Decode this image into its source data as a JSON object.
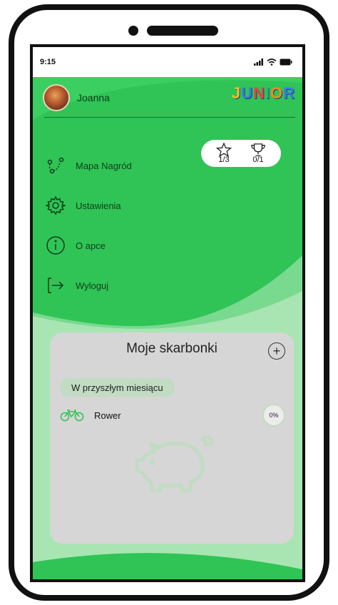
{
  "status_bar": {
    "time": "9:15"
  },
  "header": {
    "profile_name": "Joanna",
    "logo_letters": [
      "J",
      "U",
      "N",
      "I",
      "O",
      "R"
    ]
  },
  "menu": {
    "items": [
      {
        "label": "Mapa Nagród",
        "icon": "route-map-icon"
      },
      {
        "label": "Ustawienia",
        "icon": "gear-icon"
      },
      {
        "label": "O apce",
        "icon": "info-icon"
      },
      {
        "label": "Wyloguj",
        "icon": "logout-icon"
      }
    ]
  },
  "stats": {
    "stars": "1/3",
    "trophies": "0/1"
  },
  "savings": {
    "title": "Moje skarbonki",
    "group_label": "W przyszłym miesiącu",
    "goals": [
      {
        "name": "Rower",
        "progress": "0%",
        "icon": "bicycle-icon"
      }
    ]
  },
  "colors": {
    "green": "#2fc455",
    "card": "#d6d6d6",
    "chip": "#c2dcc4",
    "logo": [
      "#f2c21b",
      "#3a7be0",
      "#e8473a",
      "#2fb86a",
      "#f08a1c",
      "#3a7be0"
    ]
  }
}
